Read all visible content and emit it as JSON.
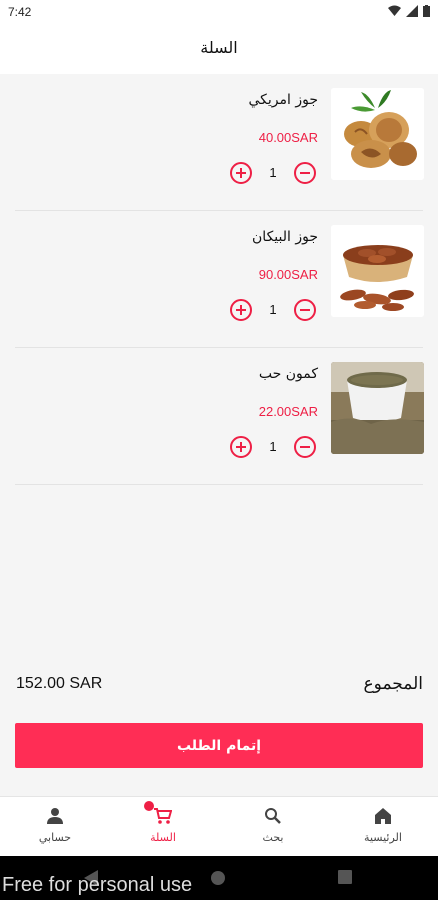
{
  "status_bar": {
    "time": "7:42"
  },
  "header": {
    "title": "السلة"
  },
  "cart": {
    "items": [
      {
        "name": "جوز امريكي",
        "price": "40.00SAR",
        "quantity": "1",
        "image": "walnuts-image"
      },
      {
        "name": "جوز البيكان",
        "price": "90.00SAR",
        "quantity": "1",
        "image": "pecans-image"
      },
      {
        "name": "كمون حب",
        "price": "22.00SAR",
        "quantity": "1",
        "image": "cumin-seeds-image"
      }
    ]
  },
  "summary": {
    "label": "المجموع",
    "value": "152.00 SAR"
  },
  "checkout": {
    "label": "إتمام الطلب"
  },
  "nav": {
    "items": [
      {
        "label": "حسابي",
        "icon": "person-icon"
      },
      {
        "label": "السلة",
        "icon": "cart-icon",
        "active": true
      },
      {
        "label": "بحث",
        "icon": "search-icon"
      },
      {
        "label": "الرئيسية",
        "icon": "home-icon"
      }
    ]
  },
  "colors": {
    "accent": "#ee1f45",
    "button": "#ff2d55"
  },
  "watermark": "Free for personal use"
}
